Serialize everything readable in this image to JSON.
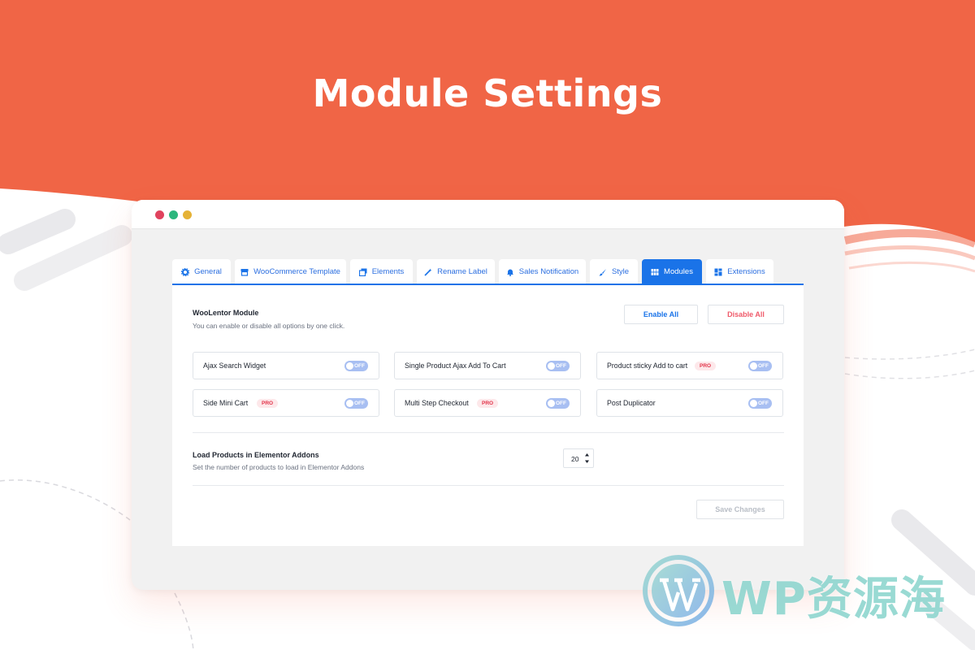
{
  "headline": "Module Settings",
  "colors": {
    "brand_orange": "#f06546",
    "accent_blue": "#1a73e8",
    "disable_red": "#ef5a6a",
    "dot_red": "#e0435e",
    "dot_green": "#2cb67d",
    "dot_yellow": "#e5b236"
  },
  "tabs": [
    {
      "label": "General",
      "icon": "gear-icon",
      "active": false
    },
    {
      "label": "WooCommerce Template",
      "icon": "store-icon",
      "active": false
    },
    {
      "label": "Elements",
      "icon": "layers-icon",
      "active": false
    },
    {
      "label": "Rename Label",
      "icon": "magic-wand-icon",
      "active": false
    },
    {
      "label": "Sales Notification",
      "icon": "bell-icon",
      "active": false
    },
    {
      "label": "Style",
      "icon": "brush-icon",
      "active": false
    },
    {
      "label": "Modules",
      "icon": "grid-icon",
      "active": true
    },
    {
      "label": "Extensions",
      "icon": "dashboard-icon",
      "active": false
    }
  ],
  "module_header": {
    "title": "WooLentor Module",
    "description": "You can enable or disable all options by one click.",
    "enable_all": "Enable All",
    "disable_all": "Disable All"
  },
  "modules": [
    {
      "label": "Ajax Search Widget",
      "pro": false,
      "state": "OFF"
    },
    {
      "label": "Single Product Ajax Add To Cart",
      "pro": false,
      "state": "OFF"
    },
    {
      "label": "Product sticky Add to cart",
      "pro": true,
      "state": "OFF"
    },
    {
      "label": "Side Mini Cart",
      "pro": true,
      "state": "OFF"
    },
    {
      "label": "Multi Step Checkout",
      "pro": true,
      "state": "OFF"
    },
    {
      "label": "Post Duplicator",
      "pro": false,
      "state": "OFF"
    }
  ],
  "pro_badge": "PRO",
  "load_products": {
    "title": "Load Products in Elementor Addons",
    "description": "Set the number of products to load in Elementor Addons",
    "value": "20"
  },
  "save_button": "Save Changes",
  "watermark": {
    "text": "WP资源海",
    "logo": "wordpress-logo-icon"
  }
}
